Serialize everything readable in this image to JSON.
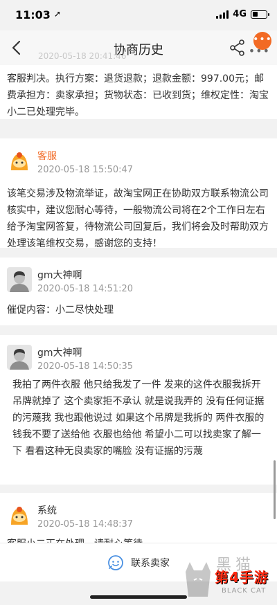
{
  "status_bar": {
    "time": "11:03",
    "location_arrow": "➚",
    "network": "4G"
  },
  "nav": {
    "title": "协商历史",
    "faded_timestamp": "2020-05-18 20:41:46",
    "back_icon": "chevron-left-icon",
    "share_icon": "share-icon",
    "more_icon": "more-icon"
  },
  "messages": [
    {
      "name": "",
      "time": "",
      "text": "客服判决。执行方案：退货退款；退款金额：997.00元；邮费承担方：卖家承担；货物状态：已收到货；维权定性：淘宝小二已处理完毕。"
    },
    {
      "name": "客服",
      "time": "2020-05-18 15:50:47",
      "text": "该笔交易涉及物流举证，故淘宝网正在协助双方联系物流公司核实中，建议您耐心等待，一般物流公司将在2个工作日左右给予淘宝网答复，待物流公司回复后，我们将会及时帮助双方处理该笔维权交易，感谢您的支持！"
    },
    {
      "name": "gm大神啊",
      "time": "2020-05-18 14:51:20",
      "text": "催促内容：小二尽快处理"
    },
    {
      "name": "gm大神啊",
      "time": "2020-05-18 14:50:35",
      "text": "我拍了两件衣服 他只给我发了一件 发来的这件衣服我拆开吊牌就掉了 这个卖家拒不承认 就是说我弄的 没有任何证据的污蔑我 我也跟他说过 如果这个吊牌是我拆的 两件衣服的钱我不要了送给他 衣服也给他 希望小二可以找卖家了解一下 看看这种无良卖家的嘴脸 没有证据的污蔑"
    },
    {
      "name": "系统",
      "time": "2020-05-18 14:48:37",
      "text": "客服小二正在处理，请耐心等待"
    }
  ],
  "footer": {
    "contact_label": "联系卖家",
    "contact_icon": "chat-smile-icon"
  },
  "watermark": {
    "text": "第4手游",
    "sub": "BLACK CAT",
    "chars": "黑猫"
  },
  "colors": {
    "accent": "#f26a24",
    "service_name": "#f26a24",
    "time": "#999999"
  }
}
